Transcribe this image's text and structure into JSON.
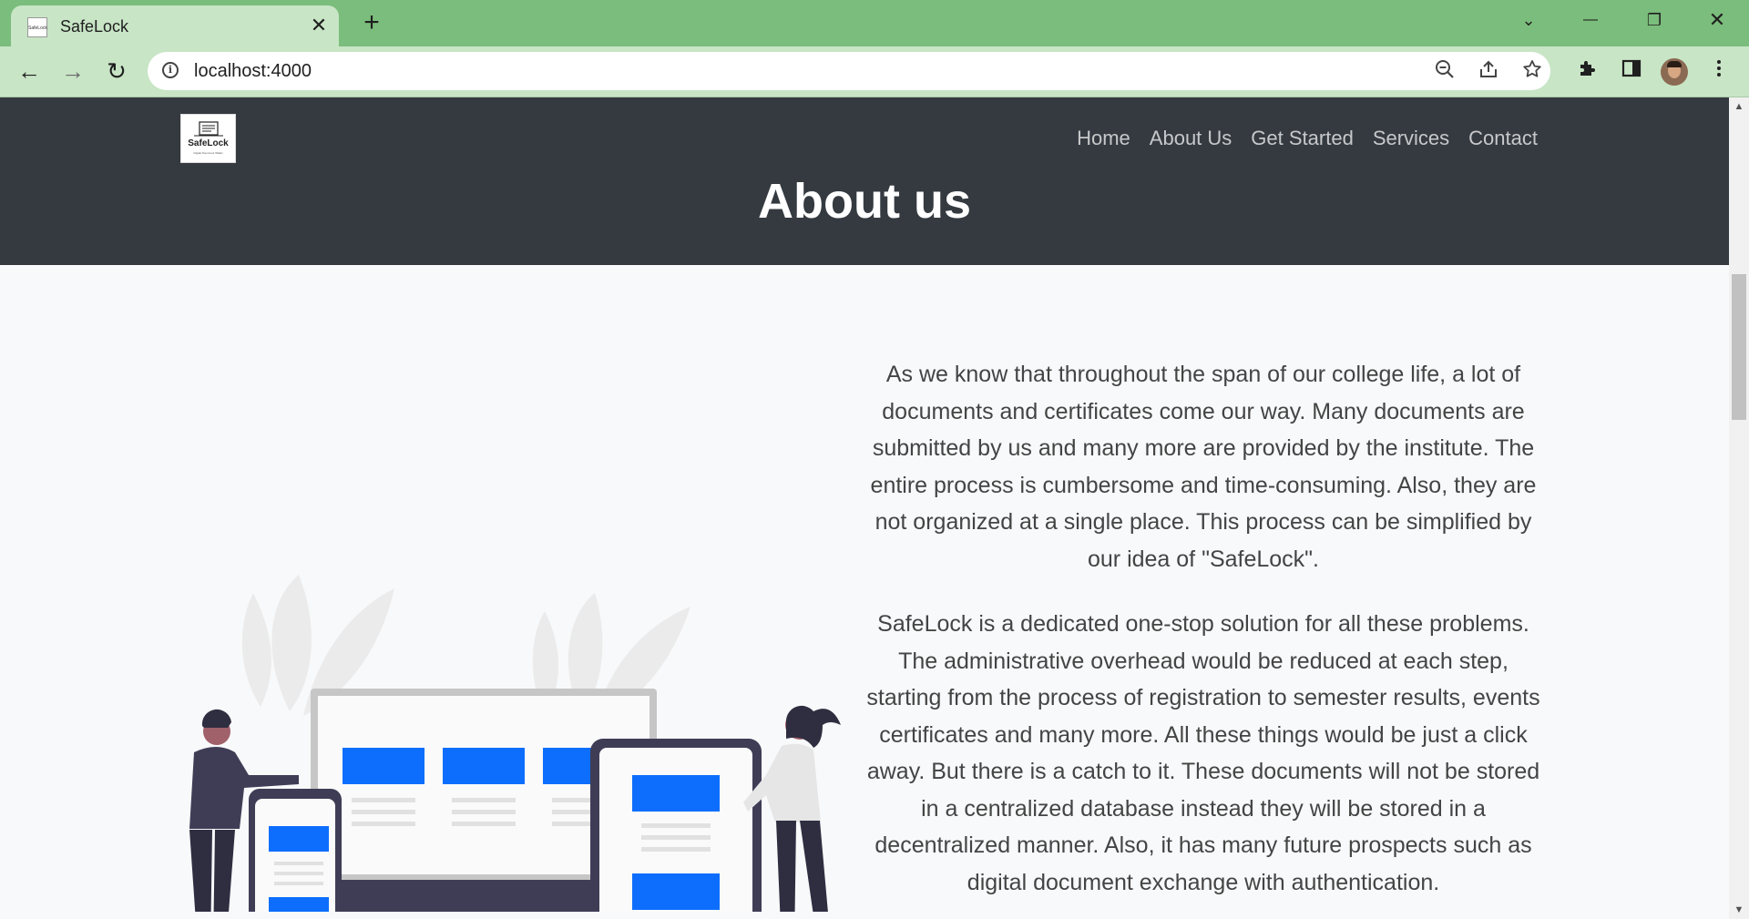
{
  "browser": {
    "tab_title": "SafeLock",
    "tab_close": "✕",
    "new_tab": "+",
    "url": "localhost:4000",
    "controls": {
      "tab_search": "⌄",
      "minimize": "—",
      "restore": "❐",
      "close": "✕"
    },
    "nav": {
      "back": "←",
      "forward": "→",
      "reload": "↻"
    },
    "icons": {
      "zoom": "zoom-out-icon",
      "share": "share-icon",
      "bookmark": "star-icon",
      "extensions": "puzzle-icon",
      "side_panel": "side-panel-icon",
      "menu": "kebab-menu-icon"
    }
  },
  "site": {
    "logo": {
      "title": "SafeLock",
      "subtitle": "Digital Document Wallet"
    },
    "nav": [
      "Home",
      "About Us",
      "Get Started",
      "Services",
      "Contact"
    ],
    "page_title": "About us",
    "paragraphs": [
      "As we know that throughout the span of our college life, a lot of documents and certificates come our way. Many documents are submitted by us and many more are provided by the institute. The entire process is cumbersome and time-consuming. Also, they are not organized at a single place. This process can be simplified by our idea of \"SafeLock\".",
      "SafeLock is a dedicated one-stop solution for all these problems. The administrative overhead would be reduced at each step, starting from the process of registration to semester results, events certificates and many more. All these things would be just a click away. But there is a catch to it. These documents will not be stored in a centralized database instead they will be stored in a decentralized manner. Also, it has many future prospects such as digital document exchange with authentication."
    ]
  },
  "colors": {
    "chrome_green": "#7bbd7c",
    "chrome_light": "#c8e5c6",
    "header_dark": "#343a40",
    "accent_blue": "#0d6efd"
  }
}
